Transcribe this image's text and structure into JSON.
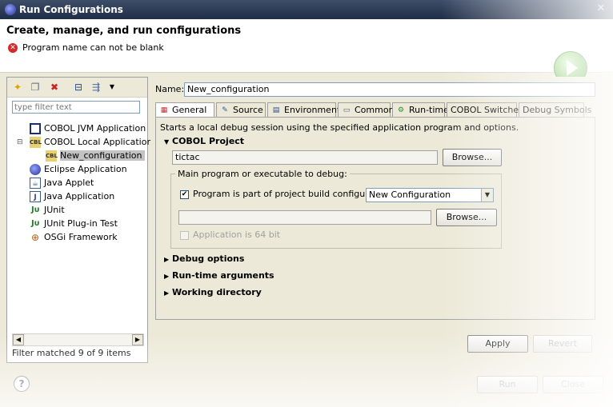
{
  "window": {
    "title": "Run Configurations",
    "close_icon": "close-icon"
  },
  "header": {
    "title": "Create, manage, and run configurations",
    "error_message": "Program name can not be blank",
    "run_icon": "run-icon"
  },
  "left_panel": {
    "toolbar": [
      "new-configuration-icon",
      "duplicate-icon",
      "delete-icon",
      "collapse-all-icon",
      "filter-icon",
      "dropdown-arrow-icon"
    ],
    "filter_placeholder": "type filter text",
    "tree": [
      {
        "label": "COBOL JVM Application",
        "icon": "cobol-jvm-icon"
      },
      {
        "label": "COBOL Local Application",
        "icon": "cobol-local-icon",
        "expanded": true,
        "children": [
          {
            "label": "New_configuration",
            "icon": "cobol-config-icon",
            "selected": true
          }
        ]
      },
      {
        "label": "Eclipse Application",
        "icon": "eclipse-icon"
      },
      {
        "label": "Java Applet",
        "icon": "java-applet-icon"
      },
      {
        "label": "Java Application",
        "icon": "java-application-icon"
      },
      {
        "label": "JUnit",
        "icon": "junit-icon"
      },
      {
        "label": "JUnit Plug-in Test",
        "icon": "junit-plugin-icon"
      },
      {
        "label": "OSGi Framework",
        "icon": "osgi-icon"
      }
    ],
    "status": "Filter matched 9 of 9 items"
  },
  "right_panel": {
    "name_label": "Name:",
    "name_value": "New_configuration",
    "tabs": [
      {
        "label": "General",
        "icon": "general-icon",
        "active": true
      },
      {
        "label": "Source",
        "icon": "source-icon"
      },
      {
        "label": "Environment",
        "icon": "environment-icon"
      },
      {
        "label": "Common",
        "icon": "common-icon"
      },
      {
        "label": "Run-time",
        "icon": "runtime-icon"
      },
      {
        "label": "COBOL Switches"
      },
      {
        "label": "Debug Symbols"
      }
    ],
    "description": "Starts a local debug session using the specified application program and options.",
    "cobol_project": {
      "label": "COBOL Project",
      "value": "tictac",
      "browse_label": "Browse..."
    },
    "main_program": {
      "group_label": "Main program or executable to debug:",
      "checkbox_label": "Program is part of project build configuration:",
      "checked": true,
      "config_value": "New Configuration",
      "browse_label": "Browse...",
      "is64_label": "Application is 64 bit"
    },
    "collapsed_sections": [
      "Debug options",
      "Run-time arguments",
      "Working directory"
    ],
    "apply_label": "Apply",
    "revert_label": "Revert"
  },
  "footer": {
    "run_label": "Run",
    "close_label": "Close",
    "help_icon": "help-icon"
  }
}
